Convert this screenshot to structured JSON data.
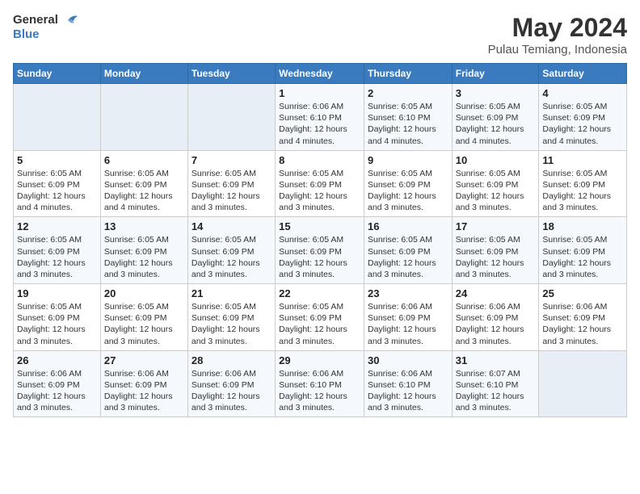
{
  "header": {
    "logo_text_line1": "General",
    "logo_text_line2": "Blue",
    "month": "May 2024",
    "location": "Pulau Temiang, Indonesia"
  },
  "weekdays": [
    "Sunday",
    "Monday",
    "Tuesday",
    "Wednesday",
    "Thursday",
    "Friday",
    "Saturday"
  ],
  "weeks": [
    [
      {
        "day": "",
        "info": ""
      },
      {
        "day": "",
        "info": ""
      },
      {
        "day": "",
        "info": ""
      },
      {
        "day": "1",
        "info": "Sunrise: 6:06 AM\nSunset: 6:10 PM\nDaylight: 12 hours\nand 4 minutes."
      },
      {
        "day": "2",
        "info": "Sunrise: 6:05 AM\nSunset: 6:10 PM\nDaylight: 12 hours\nand 4 minutes."
      },
      {
        "day": "3",
        "info": "Sunrise: 6:05 AM\nSunset: 6:09 PM\nDaylight: 12 hours\nand 4 minutes."
      },
      {
        "day": "4",
        "info": "Sunrise: 6:05 AM\nSunset: 6:09 PM\nDaylight: 12 hours\nand 4 minutes."
      }
    ],
    [
      {
        "day": "5",
        "info": "Sunrise: 6:05 AM\nSunset: 6:09 PM\nDaylight: 12 hours\nand 4 minutes."
      },
      {
        "day": "6",
        "info": "Sunrise: 6:05 AM\nSunset: 6:09 PM\nDaylight: 12 hours\nand 4 minutes."
      },
      {
        "day": "7",
        "info": "Sunrise: 6:05 AM\nSunset: 6:09 PM\nDaylight: 12 hours\nand 3 minutes."
      },
      {
        "day": "8",
        "info": "Sunrise: 6:05 AM\nSunset: 6:09 PM\nDaylight: 12 hours\nand 3 minutes."
      },
      {
        "day": "9",
        "info": "Sunrise: 6:05 AM\nSunset: 6:09 PM\nDaylight: 12 hours\nand 3 minutes."
      },
      {
        "day": "10",
        "info": "Sunrise: 6:05 AM\nSunset: 6:09 PM\nDaylight: 12 hours\nand 3 minutes."
      },
      {
        "day": "11",
        "info": "Sunrise: 6:05 AM\nSunset: 6:09 PM\nDaylight: 12 hours\nand 3 minutes."
      }
    ],
    [
      {
        "day": "12",
        "info": "Sunrise: 6:05 AM\nSunset: 6:09 PM\nDaylight: 12 hours\nand 3 minutes."
      },
      {
        "day": "13",
        "info": "Sunrise: 6:05 AM\nSunset: 6:09 PM\nDaylight: 12 hours\nand 3 minutes."
      },
      {
        "day": "14",
        "info": "Sunrise: 6:05 AM\nSunset: 6:09 PM\nDaylight: 12 hours\nand 3 minutes."
      },
      {
        "day": "15",
        "info": "Sunrise: 6:05 AM\nSunset: 6:09 PM\nDaylight: 12 hours\nand 3 minutes."
      },
      {
        "day": "16",
        "info": "Sunrise: 6:05 AM\nSunset: 6:09 PM\nDaylight: 12 hours\nand 3 minutes."
      },
      {
        "day": "17",
        "info": "Sunrise: 6:05 AM\nSunset: 6:09 PM\nDaylight: 12 hours\nand 3 minutes."
      },
      {
        "day": "18",
        "info": "Sunrise: 6:05 AM\nSunset: 6:09 PM\nDaylight: 12 hours\nand 3 minutes."
      }
    ],
    [
      {
        "day": "19",
        "info": "Sunrise: 6:05 AM\nSunset: 6:09 PM\nDaylight: 12 hours\nand 3 minutes."
      },
      {
        "day": "20",
        "info": "Sunrise: 6:05 AM\nSunset: 6:09 PM\nDaylight: 12 hours\nand 3 minutes."
      },
      {
        "day": "21",
        "info": "Sunrise: 6:05 AM\nSunset: 6:09 PM\nDaylight: 12 hours\nand 3 minutes."
      },
      {
        "day": "22",
        "info": "Sunrise: 6:05 AM\nSunset: 6:09 PM\nDaylight: 12 hours\nand 3 minutes."
      },
      {
        "day": "23",
        "info": "Sunrise: 6:06 AM\nSunset: 6:09 PM\nDaylight: 12 hours\nand 3 minutes."
      },
      {
        "day": "24",
        "info": "Sunrise: 6:06 AM\nSunset: 6:09 PM\nDaylight: 12 hours\nand 3 minutes."
      },
      {
        "day": "25",
        "info": "Sunrise: 6:06 AM\nSunset: 6:09 PM\nDaylight: 12 hours\nand 3 minutes."
      }
    ],
    [
      {
        "day": "26",
        "info": "Sunrise: 6:06 AM\nSunset: 6:09 PM\nDaylight: 12 hours\nand 3 minutes."
      },
      {
        "day": "27",
        "info": "Sunrise: 6:06 AM\nSunset: 6:09 PM\nDaylight: 12 hours\nand 3 minutes."
      },
      {
        "day": "28",
        "info": "Sunrise: 6:06 AM\nSunset: 6:09 PM\nDaylight: 12 hours\nand 3 minutes."
      },
      {
        "day": "29",
        "info": "Sunrise: 6:06 AM\nSunset: 6:10 PM\nDaylight: 12 hours\nand 3 minutes."
      },
      {
        "day": "30",
        "info": "Sunrise: 6:06 AM\nSunset: 6:10 PM\nDaylight: 12 hours\nand 3 minutes."
      },
      {
        "day": "31",
        "info": "Sunrise: 6:07 AM\nSunset: 6:10 PM\nDaylight: 12 hours\nand 3 minutes."
      },
      {
        "day": "",
        "info": ""
      }
    ]
  ]
}
